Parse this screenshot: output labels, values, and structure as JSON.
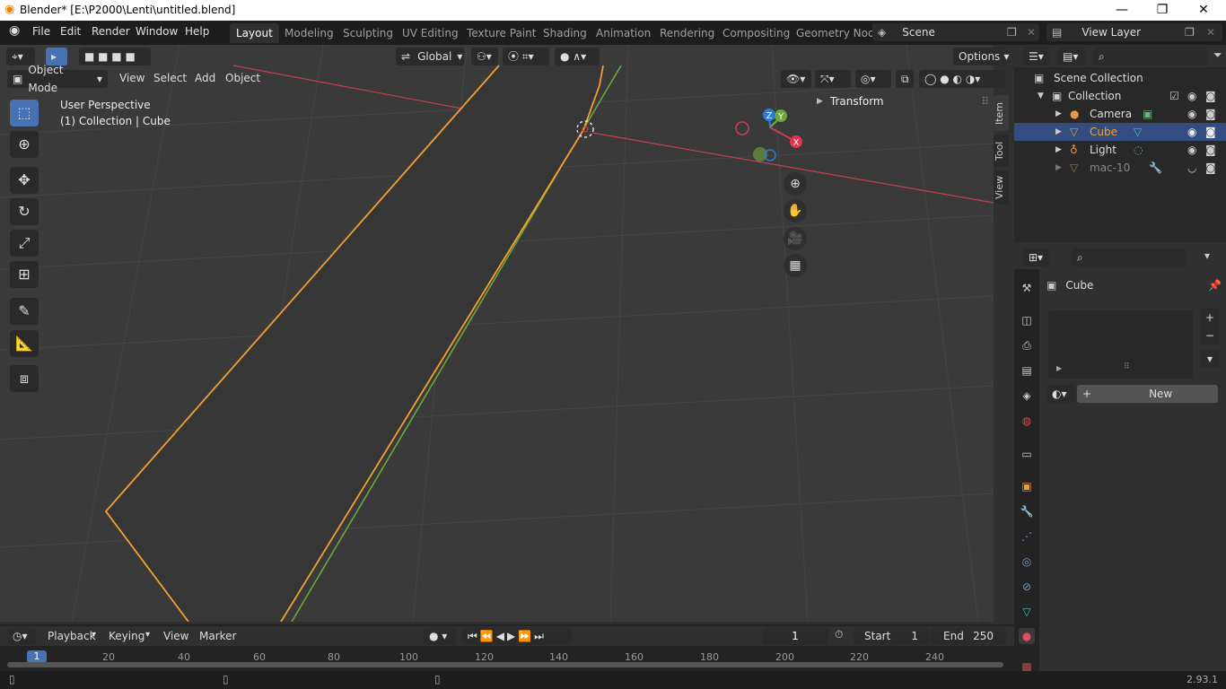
{
  "window": {
    "title": "Blender* [E:\\P2000\\Lenti\\untitled.blend]"
  },
  "menubar": {
    "file": "File",
    "edit": "Edit",
    "render": "Render",
    "window": "Window",
    "help": "Help"
  },
  "workspaces": [
    "Layout",
    "Modeling",
    "Sculpting",
    "UV Editing",
    "Texture Paint",
    "Shading",
    "Animation",
    "Rendering",
    "Compositing",
    "Geometry Nod"
  ],
  "scene": {
    "name": "Scene",
    "view_layer": "View Layer"
  },
  "viewport": {
    "transform_orientation": "Global",
    "options_label": "Options",
    "mode": "Object Mode",
    "menus": {
      "view": "View",
      "select": "Select",
      "add": "Add",
      "object": "Object"
    },
    "info_line1": "User Perspective",
    "info_line2": "(1) Collection | Cube",
    "n_panel_header": "Transform",
    "side_tabs": {
      "item": "Item",
      "tool": "Tool",
      "view": "View"
    },
    "gizmo": {
      "x": "X",
      "y": "Y",
      "z": "Z"
    }
  },
  "outliner": {
    "root": "Scene Collection",
    "collection": "Collection",
    "items": [
      {
        "name": "Camera"
      },
      {
        "name": "Cube"
      },
      {
        "name": "Light"
      },
      {
        "name": "mac-10"
      }
    ]
  },
  "properties": {
    "object_name": "Cube",
    "new_label": "New",
    "plus": "+",
    "minus": "−"
  },
  "timeline": {
    "playback": "Playback",
    "keying": "Keying",
    "view": "View",
    "marker": "Marker",
    "current_frame": "1",
    "start_label": "Start",
    "start": "1",
    "end_label": "End",
    "end": "250",
    "ticks": [
      "1",
      "20",
      "40",
      "60",
      "80",
      "100",
      "120",
      "140",
      "160",
      "180",
      "200",
      "220",
      "240"
    ]
  },
  "status": {
    "version": "2.93.1"
  },
  "colors": {
    "accent": "#4772b3",
    "selected_orange": "#f5a030",
    "axis_red": "#c4414f",
    "axis_green": "#6ca83a"
  }
}
